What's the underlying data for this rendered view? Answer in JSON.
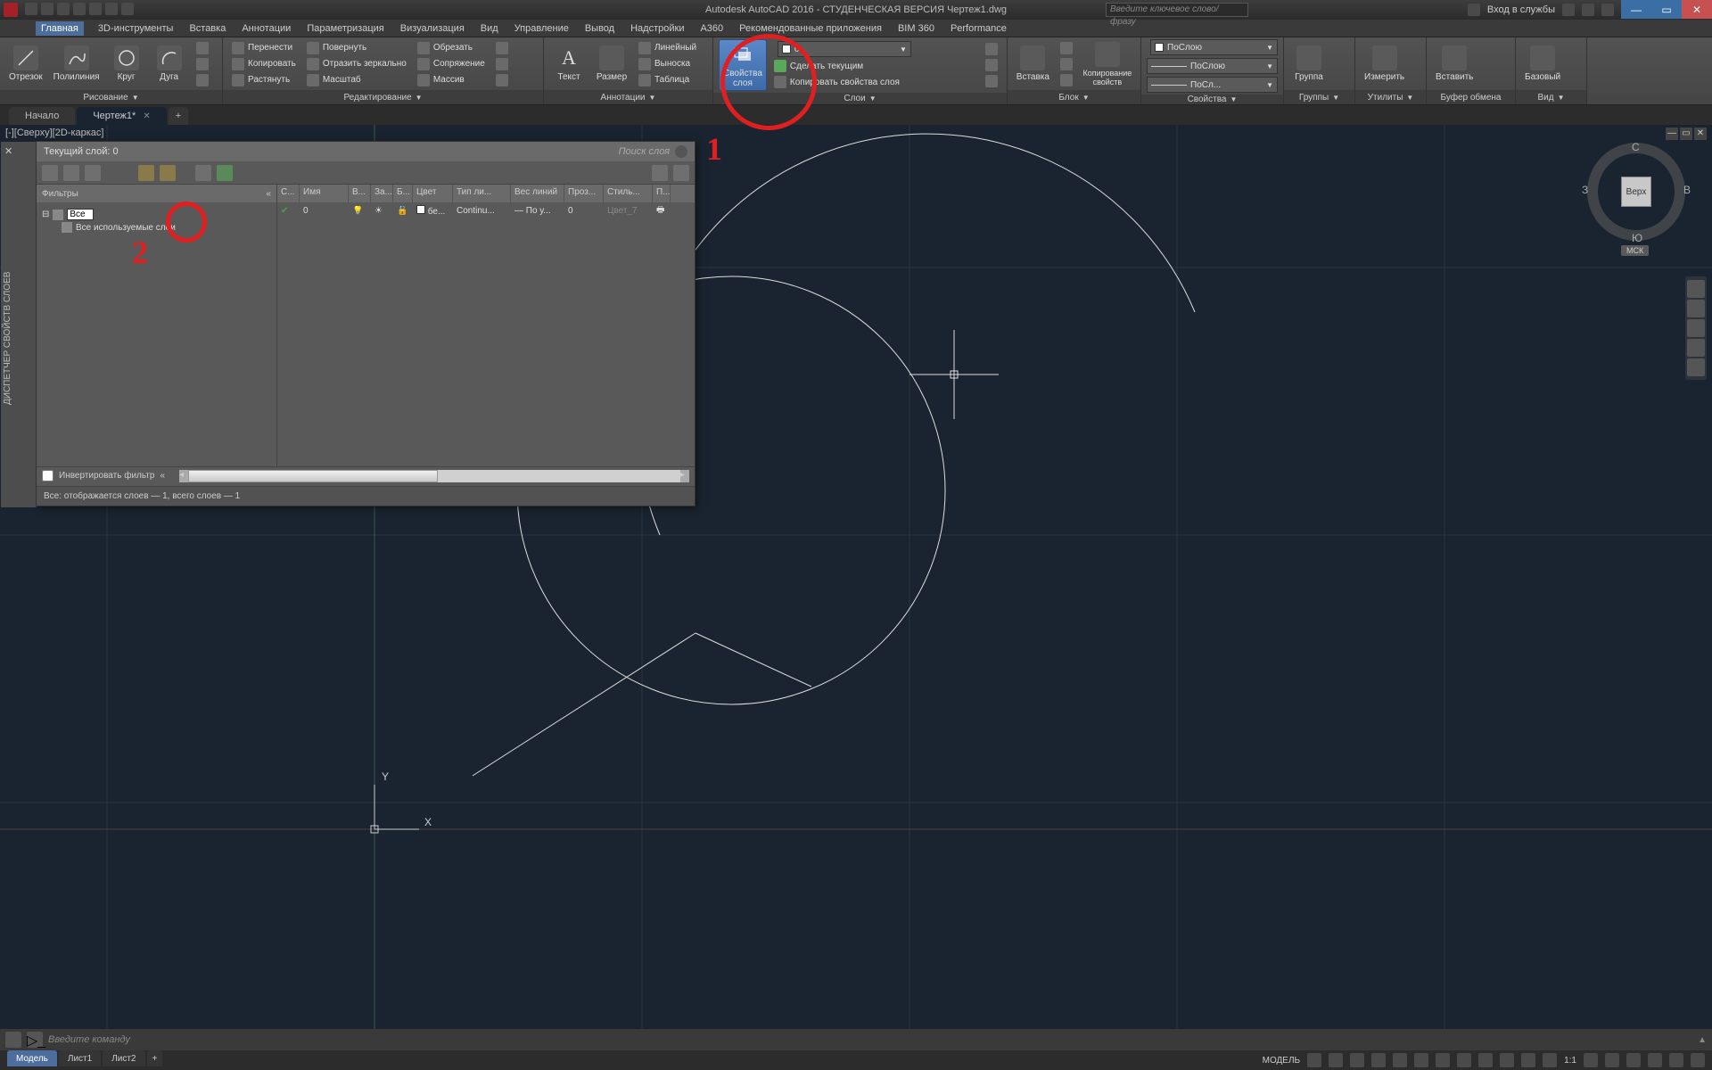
{
  "title": "Autodesk AutoCAD 2016 - СТУДЕНЧЕСКАЯ ВЕРСИЯ   Чертеж1.dwg",
  "search_placeholder": "Введите ключевое слово/фразу",
  "signin": "Вход в службы",
  "menubar": [
    "Главная",
    "3D-инструменты",
    "Вставка",
    "Аннотации",
    "Параметризация",
    "Визуализация",
    "Вид",
    "Управление",
    "Вывод",
    "Надстройки",
    "A360",
    "Рекомендованные приложения",
    "BIM 360",
    "Performance"
  ],
  "ribbon": {
    "draw": {
      "title": "Рисование",
      "items": [
        "Отрезок",
        "Полилиния",
        "Круг",
        "Дуга"
      ]
    },
    "modify": {
      "title": "Редактирование",
      "move": "Перенести",
      "copy": "Копировать",
      "stretch": "Растянуть",
      "rotate": "Повернуть",
      "mirror": "Отразить зеркально",
      "scale": "Масштаб",
      "trim": "Обрезать",
      "fillet": "Сопряжение",
      "array": "Массив"
    },
    "annot": {
      "title": "Аннотации",
      "text": "Текст",
      "dim": "Размер",
      "linear": "Линейный",
      "leader": "Выноска",
      "table": "Таблица"
    },
    "layers": {
      "title": "Слои",
      "props": "Свойства\nслоя",
      "make": "Сделать текущим",
      "match": "Копировать свойства слоя",
      "combo": "0"
    },
    "block": {
      "title": "Блок",
      "insert": "Вставка",
      "copyprops": "Копирование\nсвойств"
    },
    "props": {
      "title": "Свойства",
      "bylayer": "ПоСлою",
      "c1": "ПоСлою",
      "c2": "ПоСл..."
    },
    "groups": {
      "title": "Группы",
      "group": "Группа"
    },
    "utils": {
      "title": "Утилиты",
      "measure": "Измерить"
    },
    "clip": {
      "title": "Буфер обмена",
      "paste": "Вставить"
    },
    "view": {
      "title": "Вид",
      "base": "Базовый"
    }
  },
  "filetabs": {
    "start": "Начало",
    "doc": "Чертеж1*"
  },
  "viewport_label": "[-][Сверху][2D-каркас]",
  "viewcube": {
    "top": "Верх",
    "n": "С",
    "s": "Ю",
    "e": "В",
    "w": "З",
    "wcs": "МСК"
  },
  "layerpanel": {
    "sidebar_title": "ДИСПЕТЧЕР СВОЙСТВ СЛОЕВ",
    "current": "Текущий слой: 0",
    "search": "Поиск слоя",
    "filters_label": "Фильтры",
    "tree_all": "Все",
    "tree_used": "Все используемые слои",
    "cols": [
      "С...",
      "Имя",
      "В...",
      "За...",
      "Б...",
      "Цвет",
      "Тип ли...",
      "Вес линий",
      "Проз...",
      "Стиль...",
      "П..."
    ],
    "row": {
      "name": "0",
      "color": "бе...",
      "ltype": "Continu...",
      "lweight": "— По у...",
      "trans": "0",
      "style": "Цвет_7"
    },
    "invert": "Инвертировать фильтр",
    "status": "Все: отображается слоев — 1, всего слоев — 1"
  },
  "annotations": {
    "one": "1",
    "two": "2"
  },
  "ucs": {
    "x": "X",
    "y": "Y"
  },
  "cmdline": {
    "prompt": "Введите команду"
  },
  "layout_tabs": [
    "Модель",
    "Лист1",
    "Лист2"
  ],
  "statusbar": {
    "model": "МОДЕЛЬ",
    "scale": "1:1"
  }
}
